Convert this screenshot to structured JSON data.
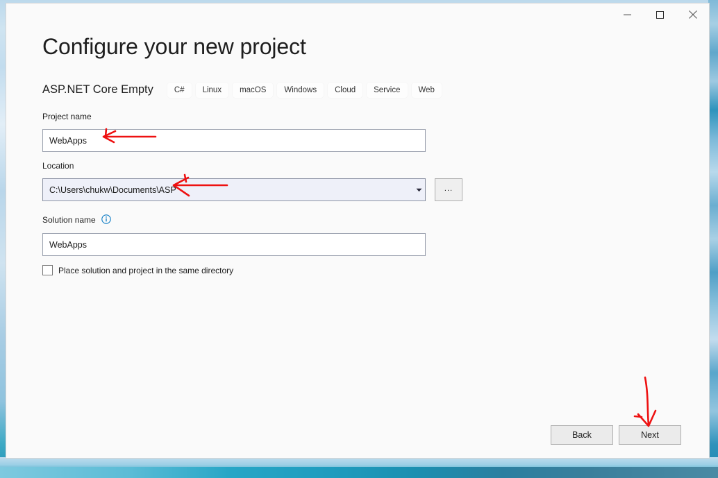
{
  "window": {
    "controls": [
      {
        "name": "minimize",
        "glyph": "minimize-icon"
      },
      {
        "name": "maximize",
        "glyph": "maximize-icon"
      },
      {
        "name": "close",
        "glyph": "close-icon"
      }
    ]
  },
  "page": {
    "title": "Configure your new project",
    "template_name": "ASP.NET Core Empty",
    "tags": [
      "C#",
      "Linux",
      "macOS",
      "Windows",
      "Cloud",
      "Service",
      "Web"
    ]
  },
  "fields": {
    "project_name": {
      "label": "Project name",
      "value": "WebApps",
      "placeholder": ""
    },
    "location": {
      "label": "Location",
      "value": "C:\\Users\\chukw\\Documents\\ASP",
      "placeholder": "",
      "browse_label": "..."
    },
    "solution_name": {
      "label": "Solution name",
      "value": "WebApps",
      "placeholder": "",
      "info_icon": "info-icon"
    },
    "same_directory": {
      "label": "Place solution and project in the same directory",
      "checked": false
    }
  },
  "footer": {
    "back_label": "Back",
    "next_label": "Next"
  },
  "annotations": {
    "color": "#ee1111",
    "arrows": [
      {
        "name": "arrow-to-project-name",
        "points_to": "project-name-input"
      },
      {
        "name": "arrow-to-location",
        "points_to": "location-combobox"
      },
      {
        "name": "arrow-to-next",
        "points_to": "next-button"
      }
    ]
  }
}
